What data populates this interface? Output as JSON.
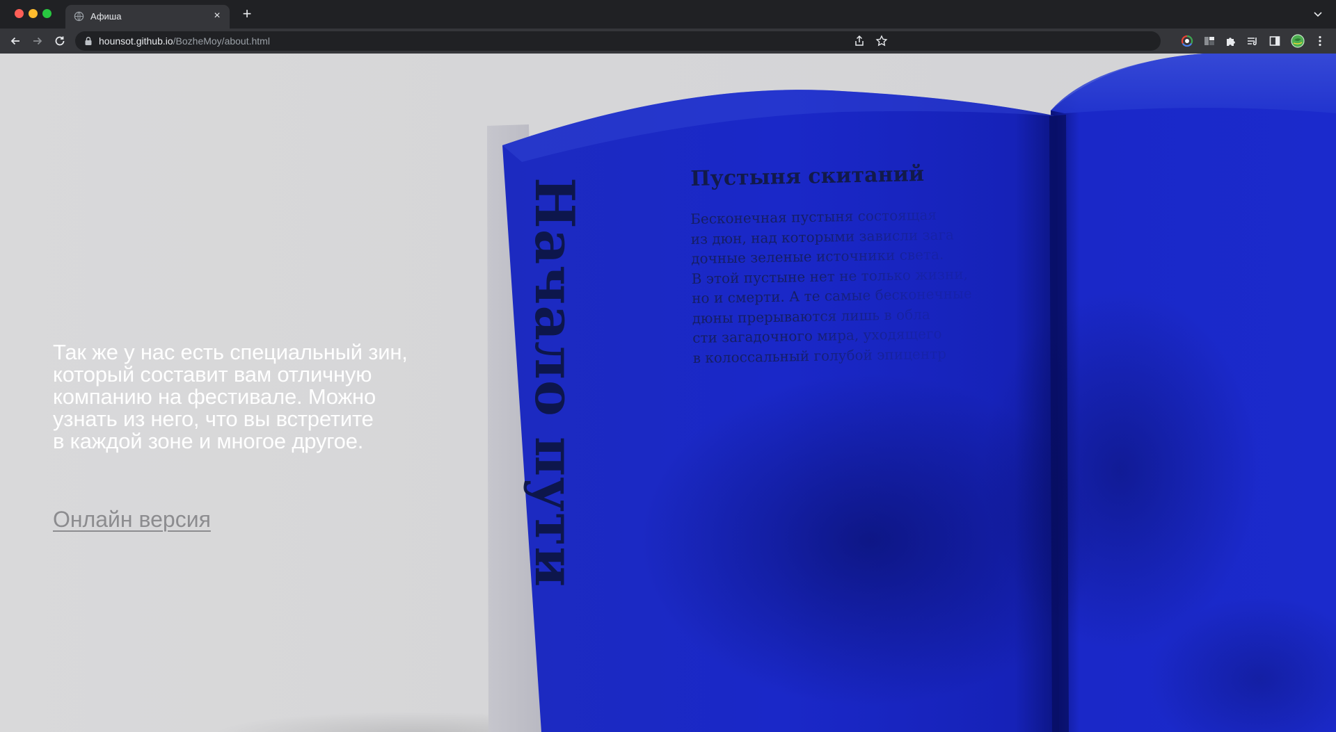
{
  "browser": {
    "tab_title": "Афиша",
    "url_host": "hounsot.github.io",
    "url_path": "/BozheMoy/about.html"
  },
  "page": {
    "intro_lines": [
      "Так же у нас есть специальный зин,",
      "который составит вам отличную",
      "компанию на фестивале. Можно",
      "узнать из него, что вы встретите",
      "в каждой зоне и многое другое."
    ],
    "online_link": "Онлайн версия"
  },
  "zine": {
    "chapter_title": "Начало пути",
    "article_title": "Пустыня скитаний",
    "article_lines": [
      "Бесконечная пустыня состоящая",
      "из дюн, над которыми зависли зага",
      "дочные зеленые источники света.",
      "В этой пустыне нет не только жизни,",
      "но и смерти. А те самые бесконечные",
      "дюны прерываются лишь в обла",
      "сти загадочного мира, уходящего",
      "в колоссальный голубой эпицентр"
    ]
  },
  "colors": {
    "page_bg": "#d8d8d9",
    "zine_blue": "#1a2bd4",
    "text_white": "#ffffff",
    "link_gray": "#8c8c8f"
  }
}
